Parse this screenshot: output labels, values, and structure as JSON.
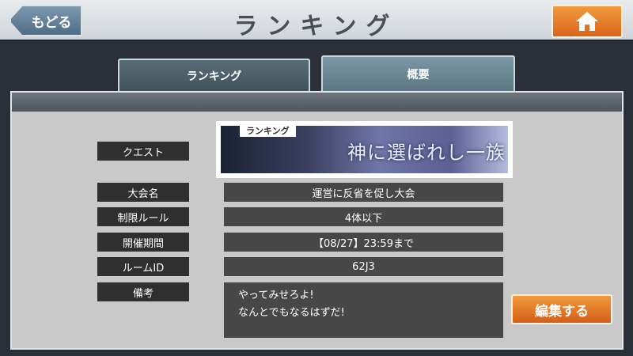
{
  "header": {
    "title": "ランキング",
    "back_label": "もどる",
    "home_icon": "home-icon"
  },
  "tabs": [
    {
      "label": "ランキング",
      "active": false
    },
    {
      "label": "概要",
      "active": true
    }
  ],
  "overview": {
    "quest_label": "クエスト",
    "banner": {
      "tag": "ランキング",
      "title": "神に選ばれし一族"
    },
    "rows": [
      {
        "label": "大会名",
        "value": "運営に反省を促し大会"
      },
      {
        "label": "制限ルール",
        "value": "4体以下"
      },
      {
        "label": "開催期間",
        "value": "【08/27】23:59まで"
      },
      {
        "label": "ルームID",
        "value": "62J3"
      }
    ],
    "note_label": "備考",
    "note_lines": [
      "やってみせろよ!",
      "なんとでもなるはずだ!"
    ],
    "edit_label": "編集する"
  },
  "colors": {
    "accent_orange": "#e07a28",
    "back_blue": "#5f7d96",
    "tab_teal": "#6d8894"
  }
}
